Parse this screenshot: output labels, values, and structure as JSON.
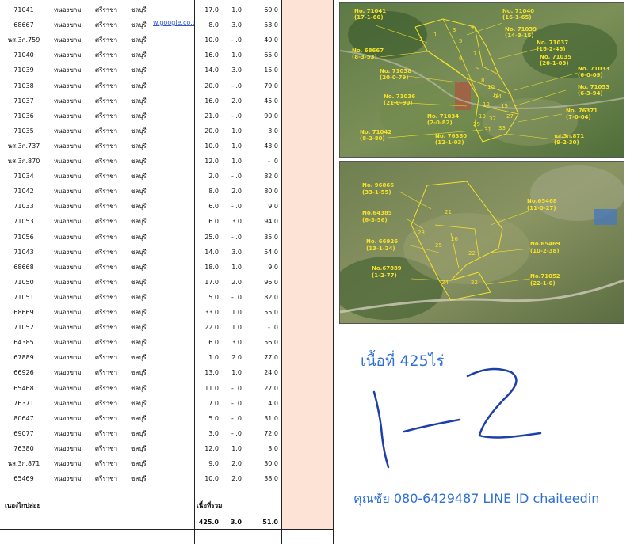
{
  "table": {
    "rows": [
      {
        "id": "71041",
        "village": "หนองขาม",
        "district": "ศรีราชา",
        "province": "ชลบุรี",
        "rai": "17.0",
        "ngan": "1.0",
        "wa": "60.0"
      },
      {
        "id": "68667",
        "village": "หนองขาม",
        "district": "ศรีราชา",
        "province": "ชลบุรี",
        "rai": "8.0",
        "ngan": "3.0",
        "wa": "53.0"
      },
      {
        "id": "นส.3ก.759",
        "village": "หนองขาม",
        "district": "ศรีราชา",
        "province": "ชลบุรี",
        "rai": "10.0",
        "ngan": "- .0",
        "wa": "40.0"
      },
      {
        "id": "71040",
        "village": "หนองขาม",
        "district": "ศรีราชา",
        "province": "ชลบุรี",
        "rai": "16.0",
        "ngan": "1.0",
        "wa": "65.0"
      },
      {
        "id": "71039",
        "village": "หนองขาม",
        "district": "ศรีราชา",
        "province": "ชลบุรี",
        "rai": "14.0",
        "ngan": "3.0",
        "wa": "15.0"
      },
      {
        "id": "71038",
        "village": "หนองขาม",
        "district": "ศรีราชา",
        "province": "ชลบุรี",
        "rai": "20.0",
        "ngan": "- .0",
        "wa": "79.0"
      },
      {
        "id": "71037",
        "village": "หนองขาม",
        "district": "ศรีราชา",
        "province": "ชลบุรี",
        "rai": "16.0",
        "ngan": "2.0",
        "wa": "45.0"
      },
      {
        "id": "71036",
        "village": "หนองขาม",
        "district": "ศรีราชา",
        "province": "ชลบุรี",
        "rai": "21.0",
        "ngan": "- .0",
        "wa": "90.0"
      },
      {
        "id": "71035",
        "village": "หนองขาม",
        "district": "ศรีราชา",
        "province": "ชลบุรี",
        "rai": "20.0",
        "ngan": "1.0",
        "wa": "3.0"
      },
      {
        "id": "นส.3ก.737",
        "village": "หนองขาม",
        "district": "ศรีราชา",
        "province": "ชลบุรี",
        "rai": "10.0",
        "ngan": "1.0",
        "wa": "43.0"
      },
      {
        "id": "นส.3ก.870",
        "village": "หนองขาม",
        "district": "ศรีราชา",
        "province": "ชลบุรี",
        "rai": "12.0",
        "ngan": "1.0",
        "wa": "- .0"
      },
      {
        "id": "71034",
        "village": "หนองขาม",
        "district": "ศรีราชา",
        "province": "ชลบุรี",
        "rai": "2.0",
        "ngan": "- .0",
        "wa": "82.0"
      },
      {
        "id": "71042",
        "village": "หนองขาม",
        "district": "ศรีราชา",
        "province": "ชลบุรี",
        "rai": "8.0",
        "ngan": "2.0",
        "wa": "80.0"
      },
      {
        "id": "71033",
        "village": "หนองขาม",
        "district": "ศรีราชา",
        "province": "ชลบุรี",
        "rai": "6.0",
        "ngan": "- .0",
        "wa": "9.0"
      },
      {
        "id": "71053",
        "village": "หนองขาม",
        "district": "ศรีราชา",
        "province": "ชลบุรี",
        "rai": "6.0",
        "ngan": "3.0",
        "wa": "94.0"
      },
      {
        "id": "71056",
        "village": "หนองขาม",
        "district": "ศรีราชา",
        "province": "ชลบุรี",
        "rai": "25.0",
        "ngan": "- .0",
        "wa": "35.0"
      },
      {
        "id": "71043",
        "village": "หนองขาม",
        "district": "ศรีราชา",
        "province": "ชลบุรี",
        "rai": "14.0",
        "ngan": "3.0",
        "wa": "54.0"
      },
      {
        "id": "68668",
        "village": "หนองขาม",
        "district": "ศรีราชา",
        "province": "ชลบุรี",
        "rai": "18.0",
        "ngan": "1.0",
        "wa": "9.0"
      },
      {
        "id": "71050",
        "village": "หนองขาม",
        "district": "ศรีราชา",
        "province": "ชลบุรี",
        "rai": "17.0",
        "ngan": "2.0",
        "wa": "96.0"
      },
      {
        "id": "71051",
        "village": "หนองขาม",
        "district": "ศรีราชา",
        "province": "ชลบุรี",
        "rai": "5.0",
        "ngan": "- .0",
        "wa": "82.0"
      },
      {
        "id": "68669",
        "village": "หนองขาม",
        "district": "ศรีราชา",
        "province": "ชลบุรี",
        "rai": "33.0",
        "ngan": "1.0",
        "wa": "55.0"
      },
      {
        "id": "71052",
        "village": "หนองขาม",
        "district": "ศรีราชา",
        "province": "ชลบุรี",
        "rai": "22.0",
        "ngan": "1.0",
        "wa": "- .0"
      },
      {
        "id": "64385",
        "village": "หนองขาม",
        "district": "ศรีราชา",
        "province": "ชลบุรี",
        "rai": "6.0",
        "ngan": "3.0",
        "wa": "56.0"
      },
      {
        "id": "67889",
        "village": "หนองขาม",
        "district": "ศรีราชา",
        "province": "ชลบุรี",
        "rai": "1.0",
        "ngan": "2.0",
        "wa": "77.0"
      },
      {
        "id": "66926",
        "village": "หนองขาม",
        "district": "ศรีราชา",
        "province": "ชลบุรี",
        "rai": "13.0",
        "ngan": "1.0",
        "wa": "24.0"
      },
      {
        "id": "65468",
        "village": "หนองขาม",
        "district": "ศรีราชา",
        "province": "ชลบุรี",
        "rai": "11.0",
        "ngan": "- .0",
        "wa": "27.0"
      },
      {
        "id": "76371",
        "village": "หนองขาม",
        "district": "ศรีราชา",
        "province": "ชลบุรี",
        "rai": "7.0",
        "ngan": "- .0",
        "wa": "4.0"
      },
      {
        "id": "80647",
        "village": "หนองขาม",
        "district": "ศรีราชา",
        "province": "ชลบุรี",
        "rai": "5.0",
        "ngan": "- .0",
        "wa": "31.0"
      },
      {
        "id": "69077",
        "village": "หนองขาม",
        "district": "ศรีราชา",
        "province": "ชลบุรี",
        "rai": "3.0",
        "ngan": "- .0",
        "wa": "72.0"
      },
      {
        "id": "76380",
        "village": "หนองขาม",
        "district": "ศรีราชา",
        "province": "ชลบุรี",
        "rai": "12.0",
        "ngan": "1.0",
        "wa": "3.0"
      },
      {
        "id": "นส.3ก.871",
        "village": "หนองขาม",
        "district": "ศรีราชา",
        "province": "ชลบุรี",
        "rai": "9.0",
        "ngan": "2.0",
        "wa": "30.0"
      },
      {
        "id": "65469",
        "village": "หนองขาม",
        "district": "ศรีราชา",
        "province": "ชลบุรี",
        "rai": "10.0",
        "ngan": "2.0",
        "wa": "38.0"
      }
    ],
    "link_text": "w.google.co.th",
    "footer_label": "เนองไกปล่อย",
    "sum_label": "เนื้อที่รวม",
    "totals": {
      "rai": "425.0",
      "ngan": "3.0",
      "wa": "51.0"
    }
  },
  "map1": {
    "labels": [
      {
        "t1": "No. 71041",
        "t2": "(17-1-60)"
      },
      {
        "t1": "No. 71040",
        "t2": "(16-1-65)"
      },
      {
        "t1": "No. 71039",
        "t2": "(14-3-15)"
      },
      {
        "t1": "No. 71037",
        "t2": "(16-2-45)"
      },
      {
        "t1": "No. 71035",
        "t2": "(20-1-03)"
      },
      {
        "t1": "No. 68667",
        "t2": "(8-3-53)"
      },
      {
        "t1": "No. 71033",
        "t2": "(6-0-09)"
      },
      {
        "t1": "No. 71038",
        "t2": "(20-0-79)"
      },
      {
        "t1": "No. 71053",
        "t2": "(6-3-94)"
      },
      {
        "t1": "No. 71036",
        "t2": "(21-0-90)"
      },
      {
        "t1": "No. 76371",
        "t2": "(7-0-04)"
      },
      {
        "t1": "No. 71034",
        "t2": "(2-0-82)"
      },
      {
        "t1": "No. 71042",
        "t2": "(8-2-80)"
      },
      {
        "t1": "No. 76380",
        "t2": "(12-1-03)"
      },
      {
        "t1": "นส.3ก.871",
        "t2": "(9-2-30)"
      }
    ],
    "plot_numbers": [
      "1",
      "2",
      "3",
      "4",
      "5",
      "6",
      "7",
      "8",
      "9",
      "10",
      "11",
      "12",
      "13",
      "14",
      "15",
      "27",
      "29",
      "31",
      "32",
      "33"
    ]
  },
  "map2": {
    "labels": [
      {
        "t1": "No. 96866",
        "t2": "(33-1-55)"
      },
      {
        "t1": "No.65468",
        "t2": "(11-0-27)"
      },
      {
        "t1": "No.64385",
        "t2": "(6-3-56)"
      },
      {
        "t1": "No. 66926",
        "t2": "(13-1-24)"
      },
      {
        "t1": "No.65469",
        "t2": "(10-2-38)"
      },
      {
        "t1": "No.67889",
        "t2": "(1-2-77)"
      },
      {
        "t1": "No.71052",
        "t2": "(22-1-0)"
      }
    ],
    "plot_numbers": [
      "21",
      "23",
      "24",
      "25",
      "26",
      "22",
      "22"
    ]
  },
  "annotation": {
    "area": "เนื้อที่ 425ไร่",
    "handwriting": "1-2",
    "contact": "คุณชัย 080-6429487 LINE ID chaiteedin"
  },
  "colors": {
    "pink": "#fde3d6",
    "map_label": "#f5e22b",
    "blue_text": "#2c6fd6"
  }
}
